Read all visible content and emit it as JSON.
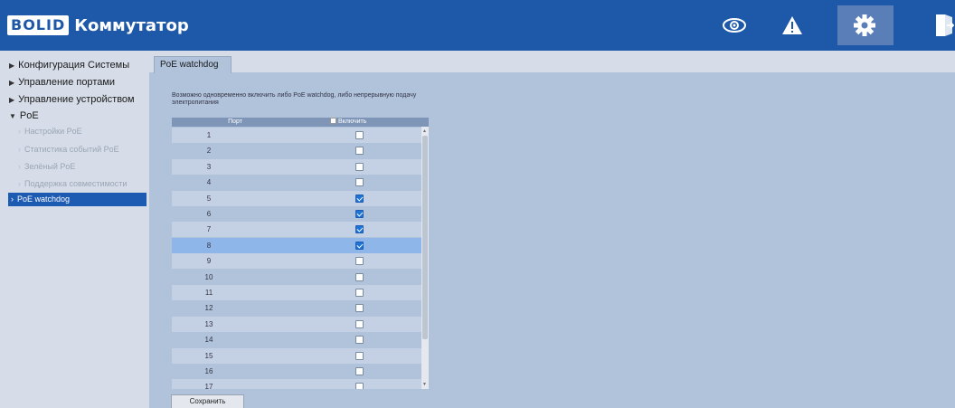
{
  "header": {
    "logo_brand": "BOLID",
    "logo_title": "Коммутатор",
    "icons": [
      "eye-icon",
      "warning-icon",
      "gear-icon",
      "logout-icon"
    ],
    "accent_color": "#1e58a8"
  },
  "sidebar": {
    "items": [
      {
        "label": "Конфигурация Системы",
        "expanded": false
      },
      {
        "label": "Управление портами",
        "expanded": false
      },
      {
        "label": "Управление устройством",
        "expanded": false
      },
      {
        "label": "PoE",
        "expanded": true
      }
    ],
    "poe_sub": [
      {
        "label": "Настройки PoE",
        "active": false
      },
      {
        "label": "Статистика событий PoE",
        "active": false
      },
      {
        "label": "Зелёный PoE",
        "active": false
      },
      {
        "label": "Поддержка совместимости",
        "active": false
      },
      {
        "label": "PoE watchdog",
        "active": true
      }
    ]
  },
  "main": {
    "tab_label": "PoE watchdog",
    "description": "Возможно одновременно включить либо PoE watchdog, либо непрерывную подачу электропитания",
    "table": {
      "col_port": "Порт",
      "col_enable": "Включить",
      "rows": [
        {
          "port": "1",
          "enabled": false
        },
        {
          "port": "2",
          "enabled": false
        },
        {
          "port": "3",
          "enabled": false
        },
        {
          "port": "4",
          "enabled": false
        },
        {
          "port": "5",
          "enabled": true
        },
        {
          "port": "6",
          "enabled": true
        },
        {
          "port": "7",
          "enabled": true
        },
        {
          "port": "8",
          "enabled": true
        },
        {
          "port": "9",
          "enabled": false
        },
        {
          "port": "10",
          "enabled": false
        },
        {
          "port": "11",
          "enabled": false
        },
        {
          "port": "12",
          "enabled": false
        },
        {
          "port": "13",
          "enabled": false
        },
        {
          "port": "14",
          "enabled": false
        },
        {
          "port": "15",
          "enabled": false
        },
        {
          "port": "16",
          "enabled": false
        },
        {
          "port": "17",
          "enabled": false
        }
      ],
      "selected_port": "8"
    },
    "save_label": "Сохранить"
  }
}
